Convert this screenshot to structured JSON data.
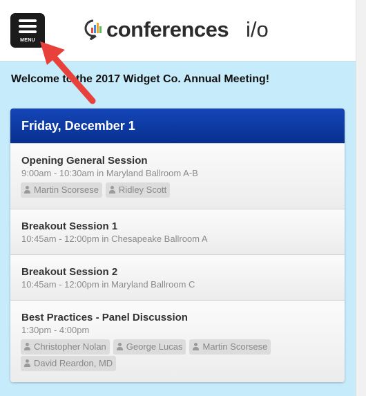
{
  "header": {
    "menu_label": "MENU",
    "brand": "conferences",
    "brand_suffix": "i/o"
  },
  "welcome": "Welcome to the 2017 Widget Co. Annual Meeting!",
  "day": "Friday, December 1",
  "sessions": [
    {
      "title": "Opening General Session",
      "meta": "9:00am - 10:30am in Maryland Ballroom A-B",
      "speakers": [
        "Martin Scorsese",
        "Ridley Scott"
      ]
    },
    {
      "title": "Breakout Session 1",
      "meta": "10:45am - 12:00pm in Chesapeake Ballroom A",
      "speakers": []
    },
    {
      "title": "Breakout Session 2",
      "meta": "10:45am - 12:00pm in Maryland Ballroom C",
      "speakers": []
    },
    {
      "title": "Best Practices - Panel Discussion",
      "meta": "1:30pm - 4:00pm",
      "speakers": [
        "Christopher Nolan",
        "George Lucas",
        "Martin Scorsese",
        "David Reardon, MD"
      ]
    }
  ],
  "colors": {
    "header_blue": "#0a3a9e",
    "page_bg": "#c6ebfb",
    "arrow": "#e8413c"
  },
  "icons": [
    "menu-icon",
    "logo-icon",
    "person-icon",
    "annotation-arrow-icon"
  ]
}
